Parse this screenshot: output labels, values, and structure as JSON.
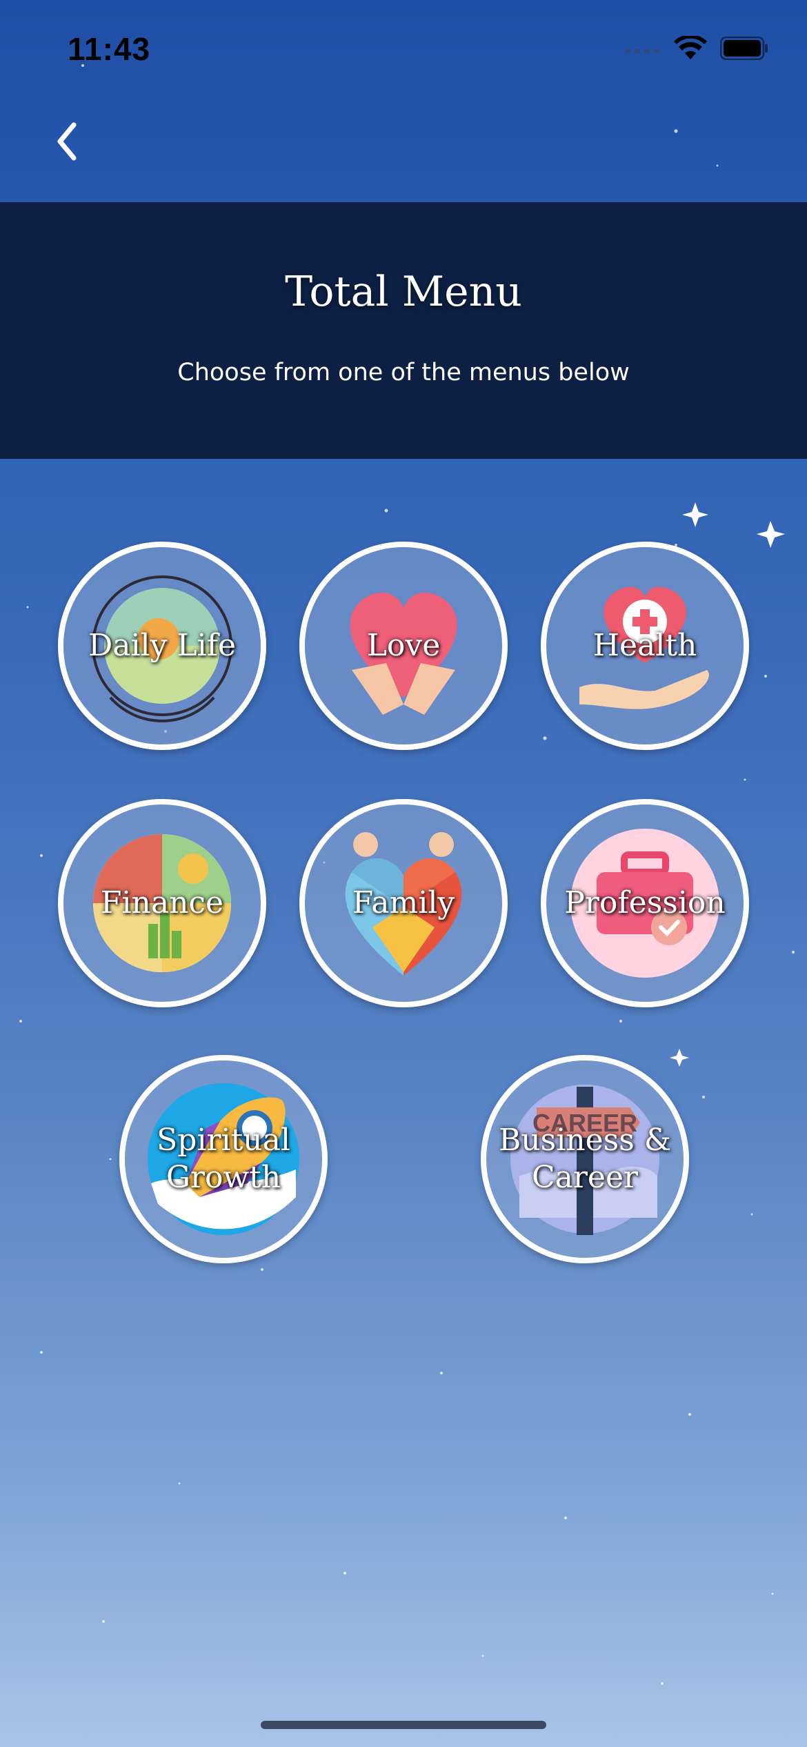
{
  "status_bar": {
    "time": "11:43"
  },
  "nav": {
    "back_icon": "chevron-left-icon"
  },
  "header": {
    "title": "Total Menu",
    "subtitle": "Choose from one of the menus below"
  },
  "menu": {
    "items": [
      {
        "label": "Daily Life",
        "icon": "sun-cycle-icon"
      },
      {
        "label": "Love",
        "icon": "heart-hands-icon"
      },
      {
        "label": "Health",
        "icon": "medical-heart-icon"
      },
      {
        "label": "Finance",
        "icon": "money-pie-icon"
      },
      {
        "label": "Family",
        "icon": "family-heart-icon"
      },
      {
        "label": "Profession",
        "icon": "briefcase-icon"
      },
      {
        "label": "Spiritual Growth",
        "icon": "rocket-icon"
      },
      {
        "label": "Business & Career",
        "icon": "career-signpost-icon"
      }
    ]
  },
  "colors": {
    "header_band": "#0d1f42",
    "ring": "#ffffff",
    "text": "#ffffff"
  }
}
